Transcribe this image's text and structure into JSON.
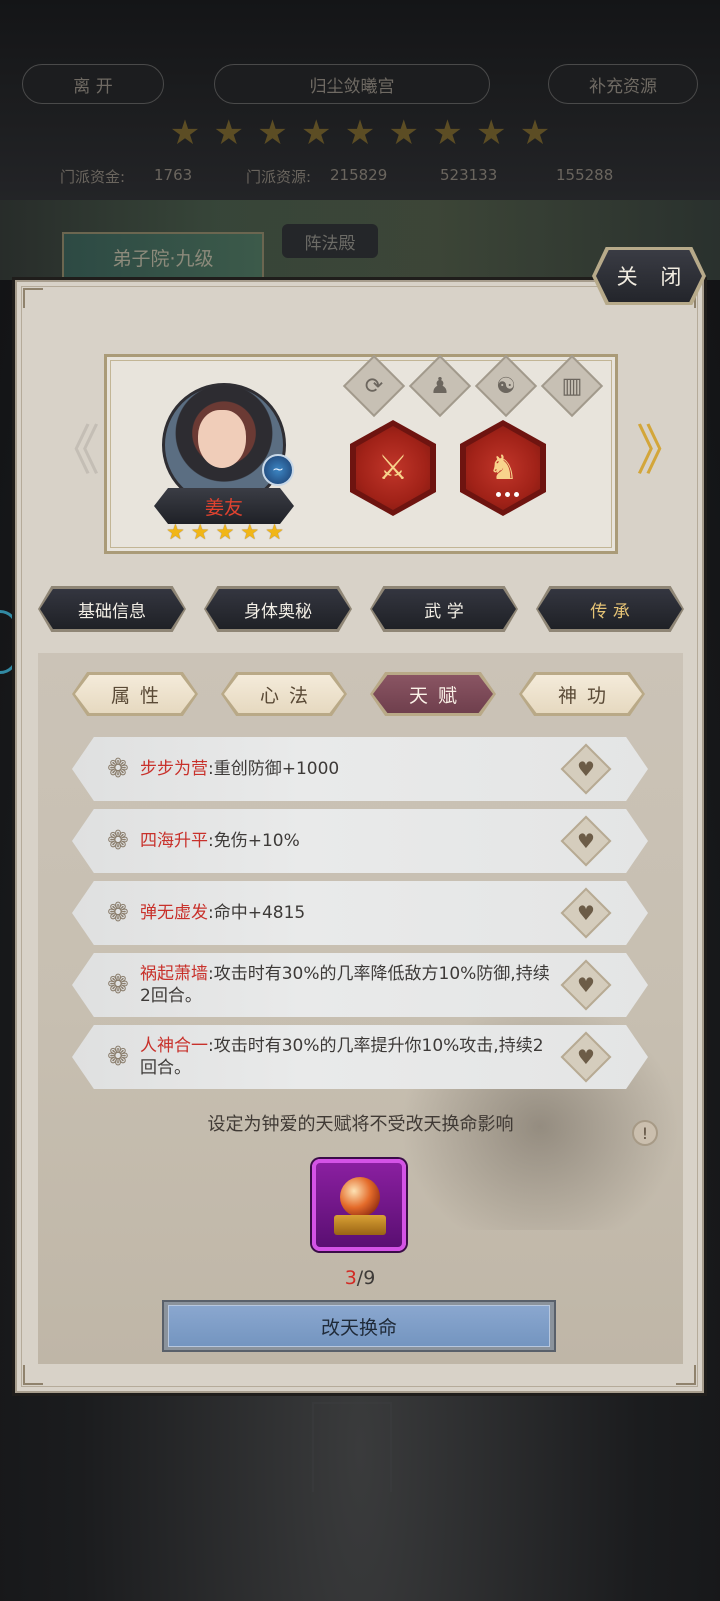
{
  "header": {
    "leave_label": "离 开",
    "title": "归尘敛曦宫",
    "supplement_label": "补充资源",
    "stars": [
      "★",
      "★",
      "★",
      "★",
      "★",
      "★",
      "★",
      "★",
      "★"
    ],
    "resources": {
      "funds_label": "门派资金:",
      "funds_value": "1763",
      "res_label": "门派资源:",
      "res_value": "215829",
      "res2_value": "523133",
      "res3_value": "155288"
    },
    "yard_tab": "弟子院·九级",
    "formation_tab": "阵法殿"
  },
  "panel": {
    "close_label": "关 闭",
    "hero": {
      "name": "姜友",
      "stars": [
        "★",
        "★",
        "★",
        "★",
        "★"
      ],
      "prev_arrow": "《",
      "next_arrow": "》"
    },
    "main_tabs": [
      {
        "label": "基础信息"
      },
      {
        "label": "身体奥秘"
      },
      {
        "label": "武 学"
      },
      {
        "label": "传 承"
      }
    ],
    "sub_tabs": [
      {
        "label": "属性"
      },
      {
        "label": "心法"
      },
      {
        "label": "天赋"
      },
      {
        "label": "神功"
      }
    ],
    "talents": [
      {
        "name": "步步为营",
        "desc": ":重创防御+1000"
      },
      {
        "name": "四海升平",
        "desc": ":免伤+10%"
      },
      {
        "name": "弹无虚发",
        "desc": ":命中+4815"
      },
      {
        "name": "祸起萧墙",
        "desc": ":攻击时有30%的几率降低敌方10%防御,持续2回合。"
      },
      {
        "name": "人神合一",
        "desc": ":攻击时有30%的几率提升你10%攻击,持续2回合。"
      }
    ],
    "hint": "设定为钟爱的天赋将不受改天换命影响",
    "info_icon": "!",
    "count_current": "3",
    "count_total": "/9",
    "reroll_label": "改天换命"
  },
  "icons": {
    "talent_flower": "❁",
    "favorite": "♥",
    "top_icons": [
      "⟳",
      "♟",
      "☯",
      "▥"
    ],
    "equip_weapon": "⚔",
    "equip_mount": "♞"
  },
  "colors": {
    "talent_name": "#c8312b",
    "active_subtab": "#7d4a58",
    "reroll_button": "#7e9dc7",
    "item_border": "#d453e6"
  }
}
